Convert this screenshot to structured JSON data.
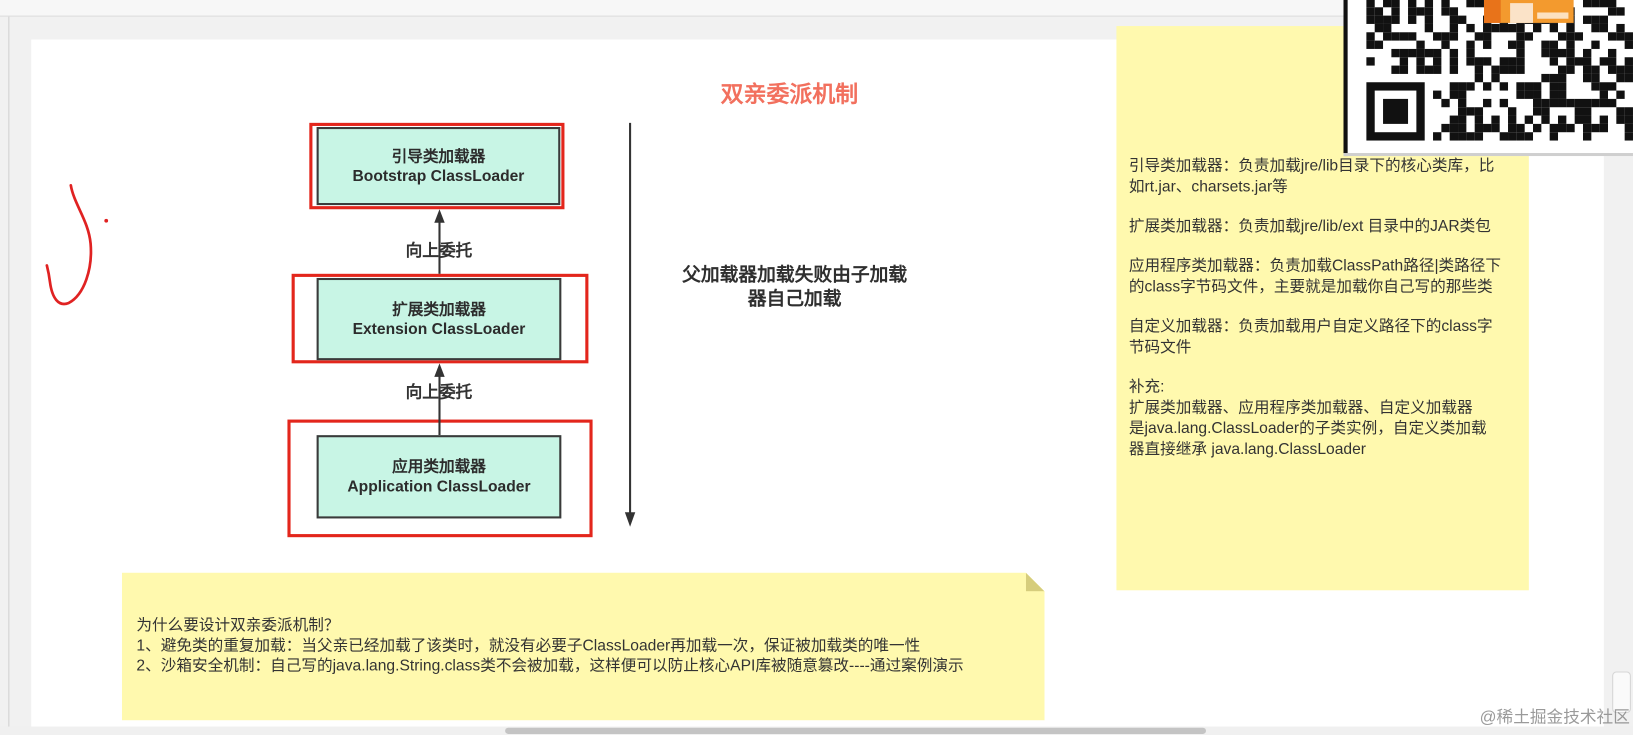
{
  "title": "双亲委派机制",
  "loaders": [
    {
      "cn": "引导类加载器",
      "en": "Bootstrap ClassLoader"
    },
    {
      "cn": "扩展类加载器",
      "en": "Extension ClassLoader"
    },
    {
      "cn": "应用类加载器",
      "en": "Application ClassLoader"
    }
  ],
  "delegate_labels": [
    "向上委托",
    "向上委托"
  ],
  "fallback_note": [
    "父加载器加载失败由子加载",
    "器自己加载"
  ],
  "right_note": {
    "paragraphs": [
      [
        "引导类加载器：负责加载jre/lib目录下的核心类库，比",
        "如rt.jar、charsets.jar等"
      ],
      [
        "扩展类加载器：负责加载jre/lib/ext 目录中的JAR类包"
      ],
      [
        "应用程序类加载器：负责加载ClassPath路径|类路径下",
        "的class字节码文件，主要就是加载你自己写的那些类"
      ],
      [
        "自定义加载器：负责加载用户自定义路径下的class字",
        "节码文件"
      ],
      [
        "补充:",
        "扩展类加载器、应用程序类加载器、自定义加载器",
        "是java.lang.ClassLoader的子类实例，自定义类加载",
        "器直接继承 java.lang.ClassLoader"
      ]
    ]
  },
  "bottom_note": {
    "lines": [
      "为什么要设计双亲委派机制？",
      "1、避免类的重复加载：当父亲已经加载了该类时，就没有必要子ClassLoader再加载一次，保证被加载类的唯一性",
      "2、沙箱安全机制：自己写的java.lang.String.class类不会被加载，这样便可以防止核心API库被随意篡改----通过案例演示"
    ]
  },
  "watermark": "@稀土掘金技术社区",
  "colors": {
    "title": "#f2705e",
    "red_highlight": "#e3261c",
    "loader_fill": "#c8f5e5",
    "sticky_note": "#fff9ae",
    "handwriting": "#e02222"
  }
}
